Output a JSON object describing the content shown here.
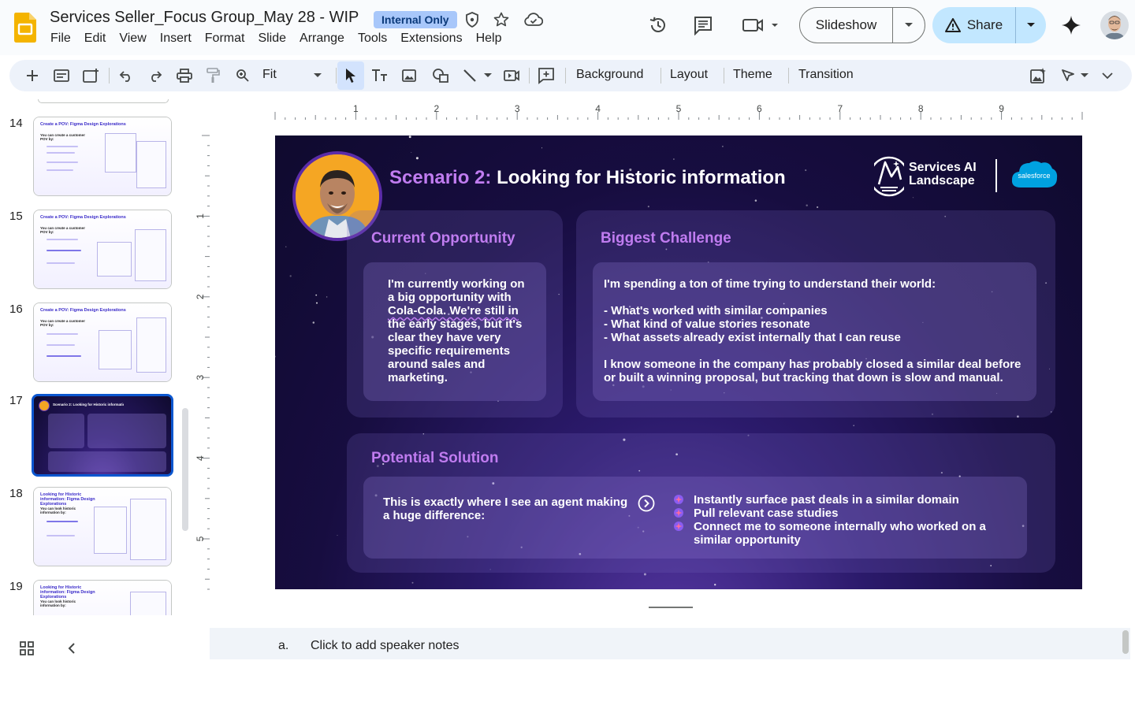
{
  "app": {
    "doc_title": "Services Seller_Focus Group_May 28 - WIP",
    "badge": "Internal Only",
    "menu": [
      "File",
      "Edit",
      "View",
      "Insert",
      "Format",
      "Slide",
      "Arrange",
      "Tools",
      "Extensions",
      "Help"
    ],
    "slideshow_label": "Slideshow",
    "share_label": "Share"
  },
  "toolbar": {
    "zoom_label": "Fit",
    "background_label": "Background",
    "layout_label": "Layout",
    "theme_label": "Theme",
    "transition_label": "Transition"
  },
  "filmstrip": {
    "thumbs": [
      {
        "num": "14",
        "title": "Create a POV: Figma Design Explorations",
        "sub": "You can create a customer POV by:"
      },
      {
        "num": "15",
        "title": "Create a POV: Figma Design Explorations",
        "sub": "You can create a customer POV by:"
      },
      {
        "num": "16",
        "title": "Create a POV: Figma Design Explorations",
        "sub": "You can create a customer POV by:"
      },
      {
        "num": "17",
        "title": "Scenario 2: Looking for Historic information",
        "sub": ""
      },
      {
        "num": "18",
        "title": "Looking for Historic information: Figma Design Explorations",
        "sub": "You can look historic information by:"
      },
      {
        "num": "19",
        "title": "Looking for Historic information: Figma Design Explorations",
        "sub": "You can look historic information by:"
      }
    ]
  },
  "ruler": {
    "h_labels": [
      "1",
      "2",
      "3",
      "4",
      "5",
      "6",
      "7",
      "8",
      "9"
    ],
    "v_labels": [
      "1",
      "2",
      "3",
      "4",
      "5"
    ]
  },
  "slide": {
    "title_accent": "Scenario 2:",
    "title_rest": "Looking for Historic information",
    "brand_line1": "Services AI",
    "brand_line2": "Landscape",
    "sf_label": "salesforce",
    "opportunity": {
      "heading": "Current Opportunity",
      "lines": [
        "I'm currently working on",
        "a big opportunity with",
        "Cola-Cola. We're still in",
        "the early stages, but it's",
        "clear they have very",
        "specific requirements",
        "around sales and",
        "marketing."
      ]
    },
    "challenge": {
      "heading": "Biggest Challenge",
      "intro": "I'm spending a ton of time trying to understand their world:",
      "bullets": [
        "- What's worked with similar companies",
        "- What kind of value stories resonate",
        "- What assets already exist internally that I can reuse"
      ],
      "outro1": "I know someone in the company has probably closed a similar deal before",
      "outro2": "or built a winning proposal, but tracking that down is slow and manual."
    },
    "solution": {
      "heading": "Potential Solution",
      "lead1": "This is exactly where I see an agent making",
      "lead2": "a huge difference:",
      "points": [
        "Instantly surface past deals in a similar domain",
        "Pull relevant case studies",
        "Connect me to someone internally who worked on a",
        "similar opportunity"
      ]
    }
  },
  "notes": {
    "number": "a.",
    "placeholder": "Click to add speaker notes"
  },
  "colors": {
    "accent_blue": "#0b57d0",
    "slide_purple_heading": "#c07cf0",
    "share_bg": "#c2e7ff",
    "badge_bg": "#a8c7fa"
  }
}
